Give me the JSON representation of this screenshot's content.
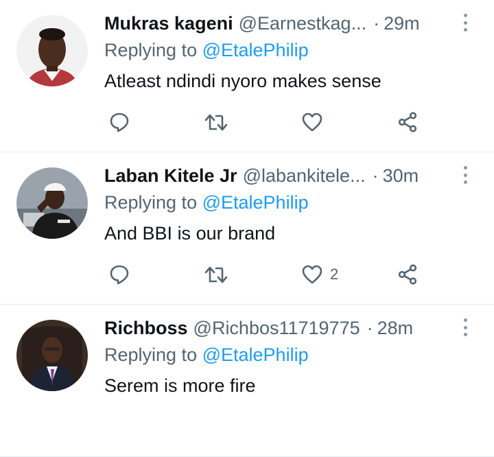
{
  "tweets": [
    {
      "name": "Mukras kageni",
      "handle": "@Earnestkag...",
      "time": "29m",
      "replying_prefix": "Replying to ",
      "replying_to": "@EtalePhilip",
      "text": "Atleast ndindi nyoro makes sense",
      "likes": ""
    },
    {
      "name": "Laban Kitele Jr",
      "handle": "@labankitele...",
      "time": "30m",
      "replying_prefix": "Replying to ",
      "replying_to": "@EtalePhilip",
      "text": "And BBI is our brand",
      "likes": "2"
    },
    {
      "name": "Richboss",
      "handle": "@Richbos11719775",
      "time": "28m",
      "replying_prefix": "Replying to ",
      "replying_to": "@EtalePhilip",
      "text": "Serem is more fire",
      "likes": ""
    }
  ],
  "separator": "·",
  "icons": {
    "reply": "reply-icon",
    "retweet": "retweet-icon",
    "like": "heart-icon",
    "share": "share-icon",
    "more": "more-options-icon"
  },
  "colors": {
    "link": "#1d9bf0",
    "secondary_text": "#536471",
    "icon": "#536471",
    "divider": "#e6ecf0"
  }
}
